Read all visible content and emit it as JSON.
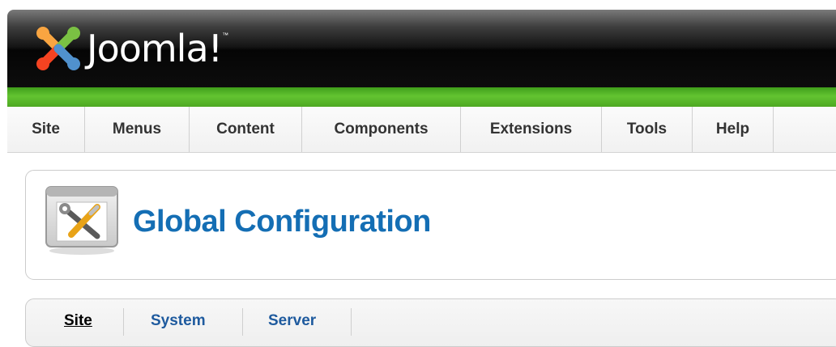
{
  "header": {
    "logo_text": "Joomla!",
    "trademark": "™"
  },
  "nav": {
    "items": [
      {
        "label": "Site"
      },
      {
        "label": "Menus"
      },
      {
        "label": "Content"
      },
      {
        "label": "Components"
      },
      {
        "label": "Extensions"
      },
      {
        "label": "Tools"
      },
      {
        "label": "Help"
      }
    ]
  },
  "page": {
    "title": "Global Configuration",
    "icon": "config-tools-icon"
  },
  "tabs": [
    {
      "label": "Site",
      "active": true
    },
    {
      "label": "System",
      "active": false
    },
    {
      "label": "Server",
      "active": false
    }
  ],
  "colors": {
    "title_blue": "#146eb4",
    "tab_link": "#1e5a9e",
    "green_bar": "#63c431"
  }
}
